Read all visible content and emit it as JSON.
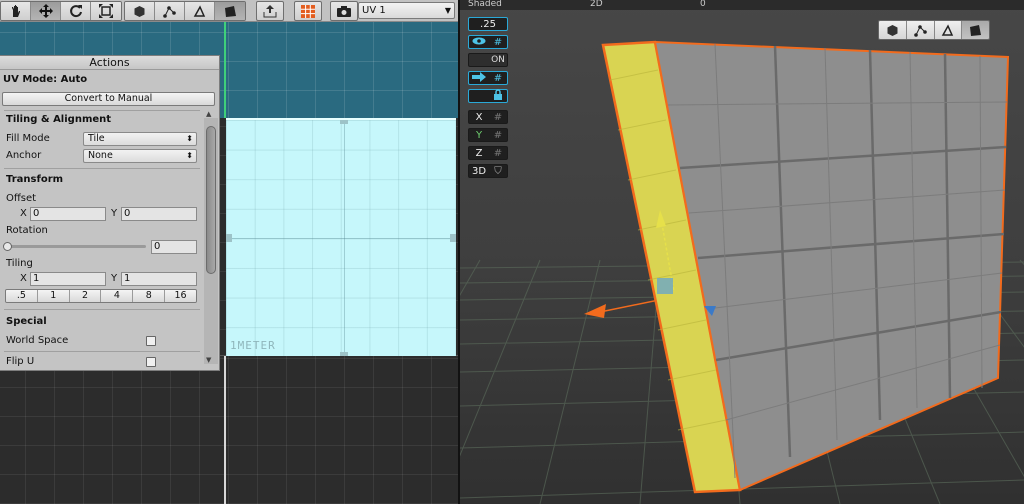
{
  "uv_toolbar": {
    "tools": [
      "hand-icon",
      "move-icon",
      "rotate-icon",
      "scale-icon"
    ],
    "select_modes": [
      "object-mode-icon",
      "vertex-mode-icon",
      "edge-mode-icon",
      "face-mode-icon"
    ],
    "export_icon": "export-icon",
    "grid_icon": "grid-snap-icon",
    "screenshot_icon": "camera-icon",
    "channel_select": "UV 1"
  },
  "actions": {
    "title": "Actions",
    "uv_mode": "UV Mode: Auto",
    "convert_button": "Convert to Manual",
    "tiling_heading": "Tiling & Alignment",
    "fill_mode_label": "Fill Mode",
    "fill_mode_value": "Tile",
    "anchor_label": "Anchor",
    "anchor_value": "None",
    "transform_heading": "Transform",
    "offset_label": "Offset",
    "offset_x_label": "X",
    "offset_x": "0",
    "offset_y_label": "Y",
    "offset_y": "0",
    "rotation_label": "Rotation",
    "rotation_value": "0",
    "tiling_label": "Tiling",
    "tiling_x_label": "X",
    "tiling_x": "1",
    "tiling_y_label": "Y",
    "tiling_y": "1",
    "tile_presets": [
      ".5",
      "1",
      "2",
      "4",
      "8",
      "16"
    ],
    "special_heading": "Special",
    "world_space_label": "World Space",
    "world_space_checked": false,
    "flip_u_label": "Flip U",
    "flip_u_checked": false
  },
  "uv_canvas": {
    "meter_label": "1METER"
  },
  "scene": {
    "shading_label": "Shaded",
    "mode_2d_label": "2D",
    "counter": "0",
    "grid_size": ".25",
    "grid_toggles": [
      {
        "left": "eye-icon",
        "right": "grid-icon"
      },
      {
        "left": "",
        "right": "ON"
      },
      {
        "left": "arrow-icon",
        "right": "grid-icon"
      },
      {
        "left": "",
        "right": "lock-icon"
      }
    ],
    "axis_buttons": [
      "X",
      "Y",
      "Z",
      "3D"
    ],
    "select_modes": [
      "object-mode-icon",
      "vertex-mode-icon",
      "edge-mode-icon",
      "face-mode-icon"
    ],
    "accent_color": "#f26b1d",
    "face_highlight_color": "#e6e04a"
  }
}
